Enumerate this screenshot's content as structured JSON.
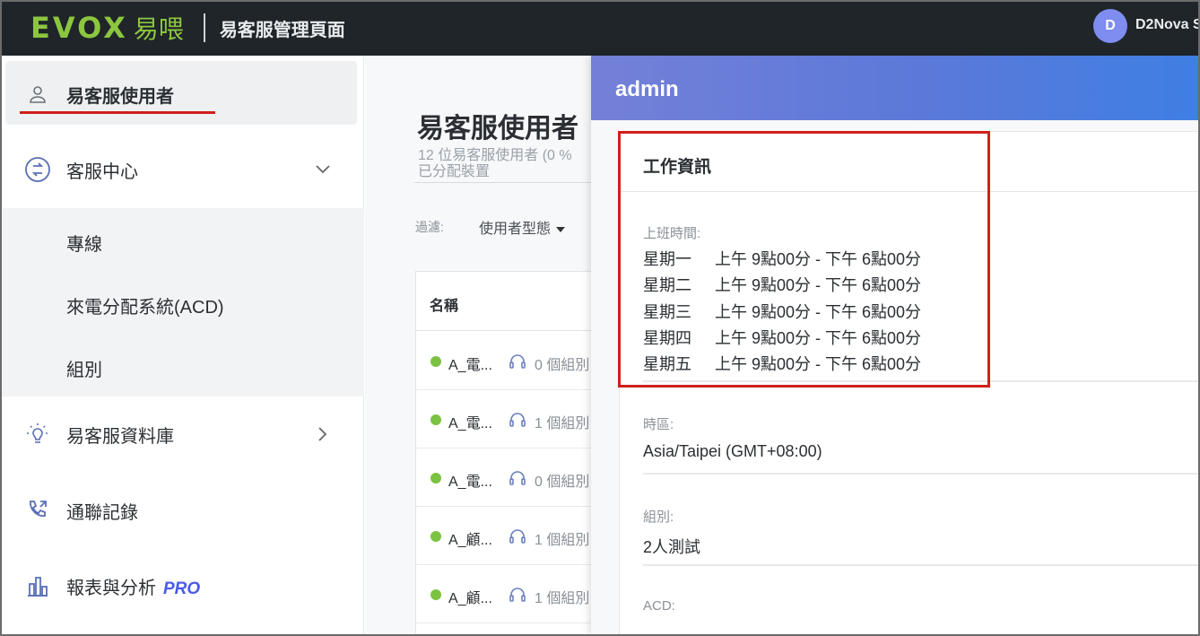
{
  "topbar": {
    "logo_text": "EVOX",
    "logo_cn": "易喂",
    "title": "易客服管理頁面",
    "avatar_initial": "D",
    "username": "D2Nova S"
  },
  "sidebar": {
    "items": [
      {
        "label": "易客服使用者",
        "icon": "user-icon"
      },
      {
        "label": "客服中心",
        "icon": "call-center-icon"
      },
      {
        "label": "易客服資料庫",
        "icon": "lightbulb-icon"
      },
      {
        "label": "通聯記錄",
        "icon": "phone-log-icon"
      },
      {
        "label": "報表與分析",
        "icon": "bar-chart-icon",
        "badge": "PRO"
      }
    ],
    "submenu": [
      "專線",
      "來電分配系統(ACD)",
      "組別"
    ]
  },
  "main": {
    "title": "易客服使用者",
    "subtitle_line1": "12 位易客服使用者 (0 %",
    "subtitle_line2": "已分配裝置",
    "filter_label": "過濾:",
    "filter_dropdown": "使用者型態",
    "table": {
      "header_name": "名稱",
      "rows": [
        {
          "name": "A_電...",
          "group": "0 個組別"
        },
        {
          "name": "A_電...",
          "group": "1 個組別"
        },
        {
          "name": "A_電...",
          "group": "0 個組別"
        },
        {
          "name": "A_顧...",
          "group": "1 個組別"
        },
        {
          "name": "A_顧...",
          "group": "1 個組別"
        }
      ]
    }
  },
  "drawer": {
    "title": "admin",
    "section_title": "工作資訊",
    "work_hours_label": "上班時間:",
    "schedule": [
      {
        "day": "星期一",
        "hours": "上午 9點00分 - 下午 6點00分"
      },
      {
        "day": "星期二",
        "hours": "上午 9點00分 - 下午 6點00分"
      },
      {
        "day": "星期三",
        "hours": "上午 9點00分 - 下午 6點00分"
      },
      {
        "day": "星期四",
        "hours": "上午 9點00分 - 下午 6點00分"
      },
      {
        "day": "星期五",
        "hours": "上午 9點00分 - 下午 6點00分"
      }
    ],
    "timezone_label": "時區:",
    "timezone_value": "Asia/Taipei (GMT+08:00)",
    "group_label": "組別:",
    "group_value": "2人測試",
    "acd_label": "ACD:"
  },
  "colors": {
    "topbar_bg": "#1f2529",
    "logo_green": "#8cc63f",
    "highlight_red": "#d0201b",
    "online_green": "#7cc242",
    "drawer_header_start": "#7480d8",
    "drawer_header_end": "#3f7fe3",
    "pro_blue": "#4a5ae8"
  }
}
